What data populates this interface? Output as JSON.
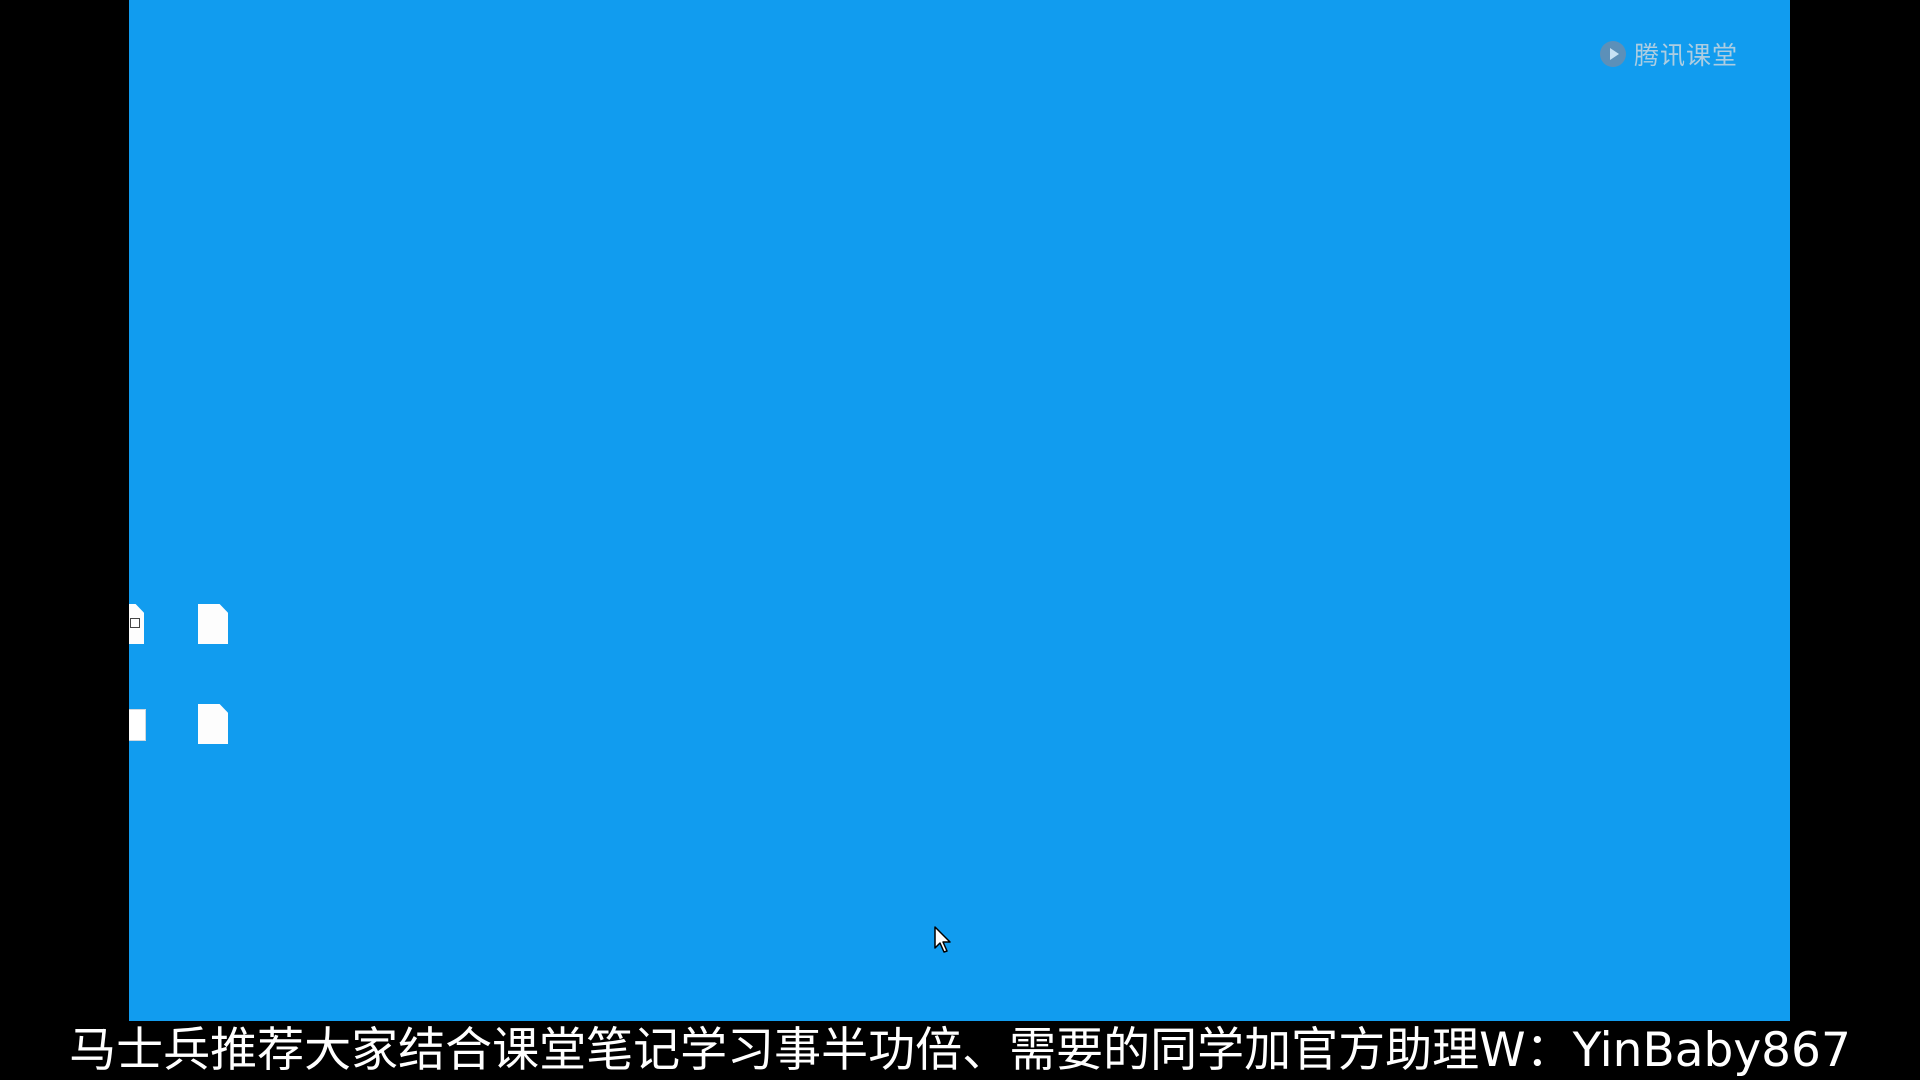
{
  "watermark": {
    "text": "腾讯课堂",
    "icon": "tencent-classroom-play-icon"
  },
  "desktop": {
    "background_color": "#119cef",
    "icons": [
      {
        "name": "desktop-icon-image-file",
        "icon": "image-file-icon",
        "label": ""
      },
      {
        "name": "desktop-icon-doc-file-1",
        "icon": "document-file-icon",
        "label": ""
      },
      {
        "name": "desktop-icon-window-app",
        "icon": "window-app-icon",
        "label": ""
      },
      {
        "name": "desktop-icon-doc-file-2",
        "icon": "document-file-icon",
        "label": ""
      }
    ]
  },
  "cursor": {
    "icon": "mouse-pointer-icon"
  },
  "subtitle": {
    "text": "马士兵推荐大家结合课堂笔记学习事半功倍、需要的同学加官方助理W：YinBaby867"
  }
}
